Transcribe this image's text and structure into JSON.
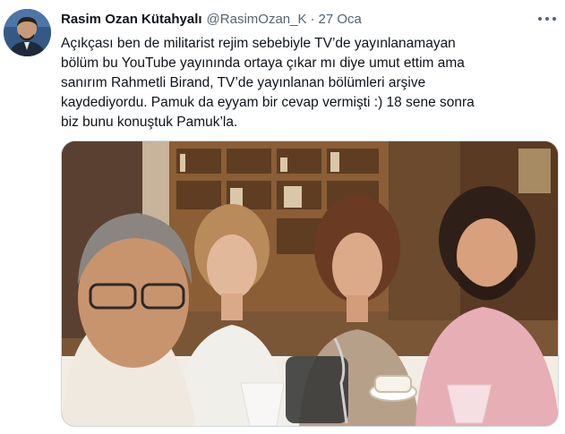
{
  "tweet": {
    "author": {
      "display_name": "Rasim Ozan Kütahyalı",
      "handle": "@RasimOzan_K",
      "separator": "·",
      "date": "27 Oca"
    },
    "text_lines": [
      "Açıkçası ben de militarist rejim sebebiyle TV’de yayınlanamayan",
      "bölüm bu YouTube yayınında ortaya çıkar mı diye umut ettim ama",
      "sanırım Rahmetli Birand, TV’de yayınlanan bölümleri arşive",
      "kaydediyordu. Pamuk da eyyam bir cevap vermişti :) 18 sene sonra",
      "biz bunu konuştuk Pamuk’la."
    ],
    "more_icon": "more-horizontal-icon",
    "media": {
      "kind": "photo",
      "subject": "four people seated at a dinner table in front of bookshelves"
    }
  },
  "colors": {
    "text_primary": "#0f1419",
    "text_secondary": "#536471",
    "media_border": "#cfd9de"
  }
}
